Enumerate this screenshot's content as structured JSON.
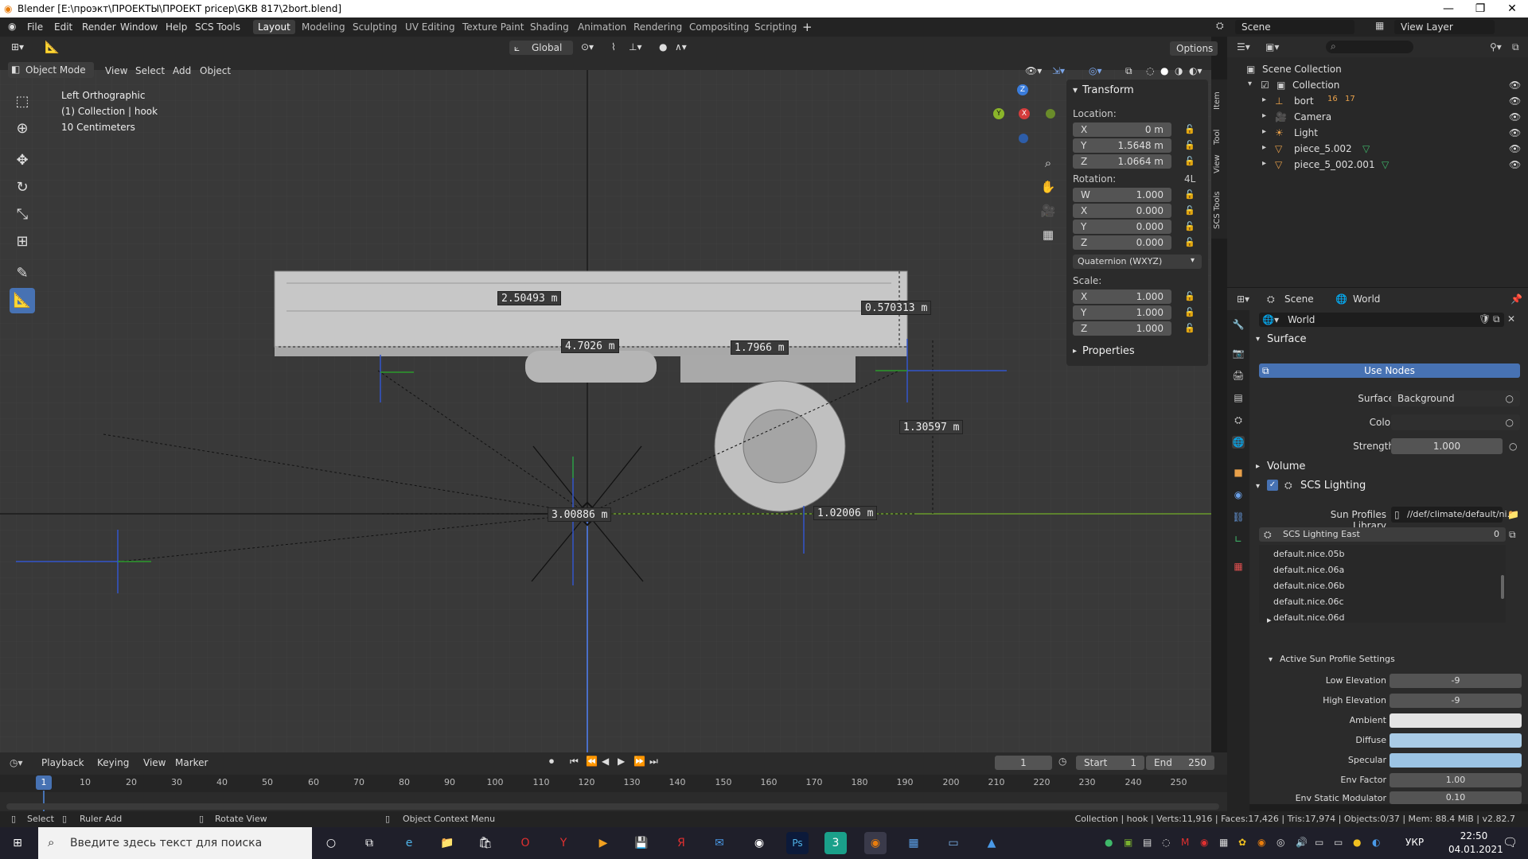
{
  "window": {
    "title": "Blender [E:\\проэкт\\ПРОЕКТЫ\\ПРОЕКТ pricep\\GKB 817\\2bort.blend]"
  },
  "menus": [
    "File",
    "Edit",
    "Render",
    "Window",
    "Help",
    "SCS Tools"
  ],
  "workspaces": [
    "Layout",
    "Modeling",
    "Sculpting",
    "UV Editing",
    "Texture Paint",
    "Shading",
    "Animation",
    "Rendering",
    "Compositing",
    "Scripting"
  ],
  "top_right": {
    "scene": "Scene",
    "view_layer": "View Layer"
  },
  "viewport": {
    "mode": "Object Mode",
    "menus": [
      "View",
      "Select",
      "Add",
      "Object"
    ],
    "orientation": "Global",
    "options": "Options",
    "overlay": [
      "Left Orthographic",
      "(1) Collection | hook",
      "10 Centimeters"
    ],
    "measurements": [
      "2.50493 m",
      "0.570313 m",
      "4.7026 m",
      "1.7966 m",
      "1.30597 m",
      "3.00886 m",
      "1.02006 m"
    ]
  },
  "npanel": {
    "header": "Transform",
    "location_label": "Location:",
    "location": [
      {
        "axis": "X",
        "value": "0 m"
      },
      {
        "axis": "Y",
        "value": "1.5648 m"
      },
      {
        "axis": "Z",
        "value": "1.0664 m"
      }
    ],
    "rotation_label": "Rotation:",
    "rotation_extra": "4L",
    "rotation": [
      {
        "axis": "W",
        "value": "1.000"
      },
      {
        "axis": "X",
        "value": "0.000"
      },
      {
        "axis": "Y",
        "value": "0.000"
      },
      {
        "axis": "Z",
        "value": "0.000"
      }
    ],
    "rotation_mode": "Quaternion (WXYZ)",
    "scale_label": "Scale:",
    "scale": [
      {
        "axis": "X",
        "value": "1.000"
      },
      {
        "axis": "Y",
        "value": "1.000"
      },
      {
        "axis": "Z",
        "value": "1.000"
      }
    ],
    "properties": "Properties",
    "tabs": [
      "Item",
      "Tool",
      "View",
      "SCS Tools"
    ]
  },
  "outliner": {
    "root": "Scene Collection",
    "collection": "Collection",
    "items": [
      "bort",
      "Camera",
      "Light",
      "piece_5.002",
      "piece_5_002.001"
    ],
    "bort_badges": [
      "16",
      "17"
    ]
  },
  "properties": {
    "scene": "Scene",
    "world": "World",
    "world_name": "World",
    "surface_header": "Surface",
    "use_nodes": "Use Nodes",
    "surface_label": "Surface",
    "surface_value": "Background",
    "color_label": "Color",
    "strength_label": "Strength",
    "strength_value": "1.000",
    "volume_header": "Volume",
    "scs_lighting": "SCS Lighting",
    "sun_profiles_label": "Sun Profiles Library",
    "sun_profiles_value": "//def/climate/default/ni...",
    "lighting_name": "SCS Lighting East",
    "lighting_count": "0",
    "profiles": [
      "default.nice.05b",
      "default.nice.06a",
      "default.nice.06b",
      "default.nice.06c",
      "default.nice.06d"
    ],
    "active_header": "Active Sun Profile Settings",
    "settings": [
      {
        "label": "Low Elevation",
        "value": "-9"
      },
      {
        "label": "High Elevation",
        "value": "-9"
      },
      {
        "label": "Ambient",
        "value": ""
      },
      {
        "label": "Diffuse",
        "value": ""
      },
      {
        "label": "Specular",
        "value": ""
      },
      {
        "label": "Env Factor",
        "value": "1.00"
      },
      {
        "label": "Env Static Modulator",
        "value": "0.10"
      }
    ]
  },
  "timeline": {
    "menus": [
      "Playback",
      "Keying",
      "View",
      "Marker"
    ],
    "current_frame": "1",
    "start_label": "Start",
    "start": "1",
    "end_label": "End",
    "end": "250",
    "ticks": [
      "1",
      "10",
      "20",
      "30",
      "40",
      "50",
      "60",
      "70",
      "80",
      "90",
      "100",
      "110",
      "120",
      "130",
      "140",
      "150",
      "160",
      "170",
      "180",
      "190",
      "200",
      "210",
      "220",
      "230",
      "240",
      "250"
    ]
  },
  "status": {
    "select": "Select",
    "ruler": "Ruler Add",
    "rotate": "Rotate View",
    "context": "Object Context Menu",
    "stats": "Collection | hook | Verts:11,916 | Faces:17,426 | Tris:17,974 | Objects:0/37 | Mem: 88.4 MiB | v2.82.7"
  },
  "taskbar": {
    "search_placeholder": "Введите здесь текст для поиска",
    "lang": "УКР",
    "time": "22:50",
    "date": "04.01.2021"
  }
}
